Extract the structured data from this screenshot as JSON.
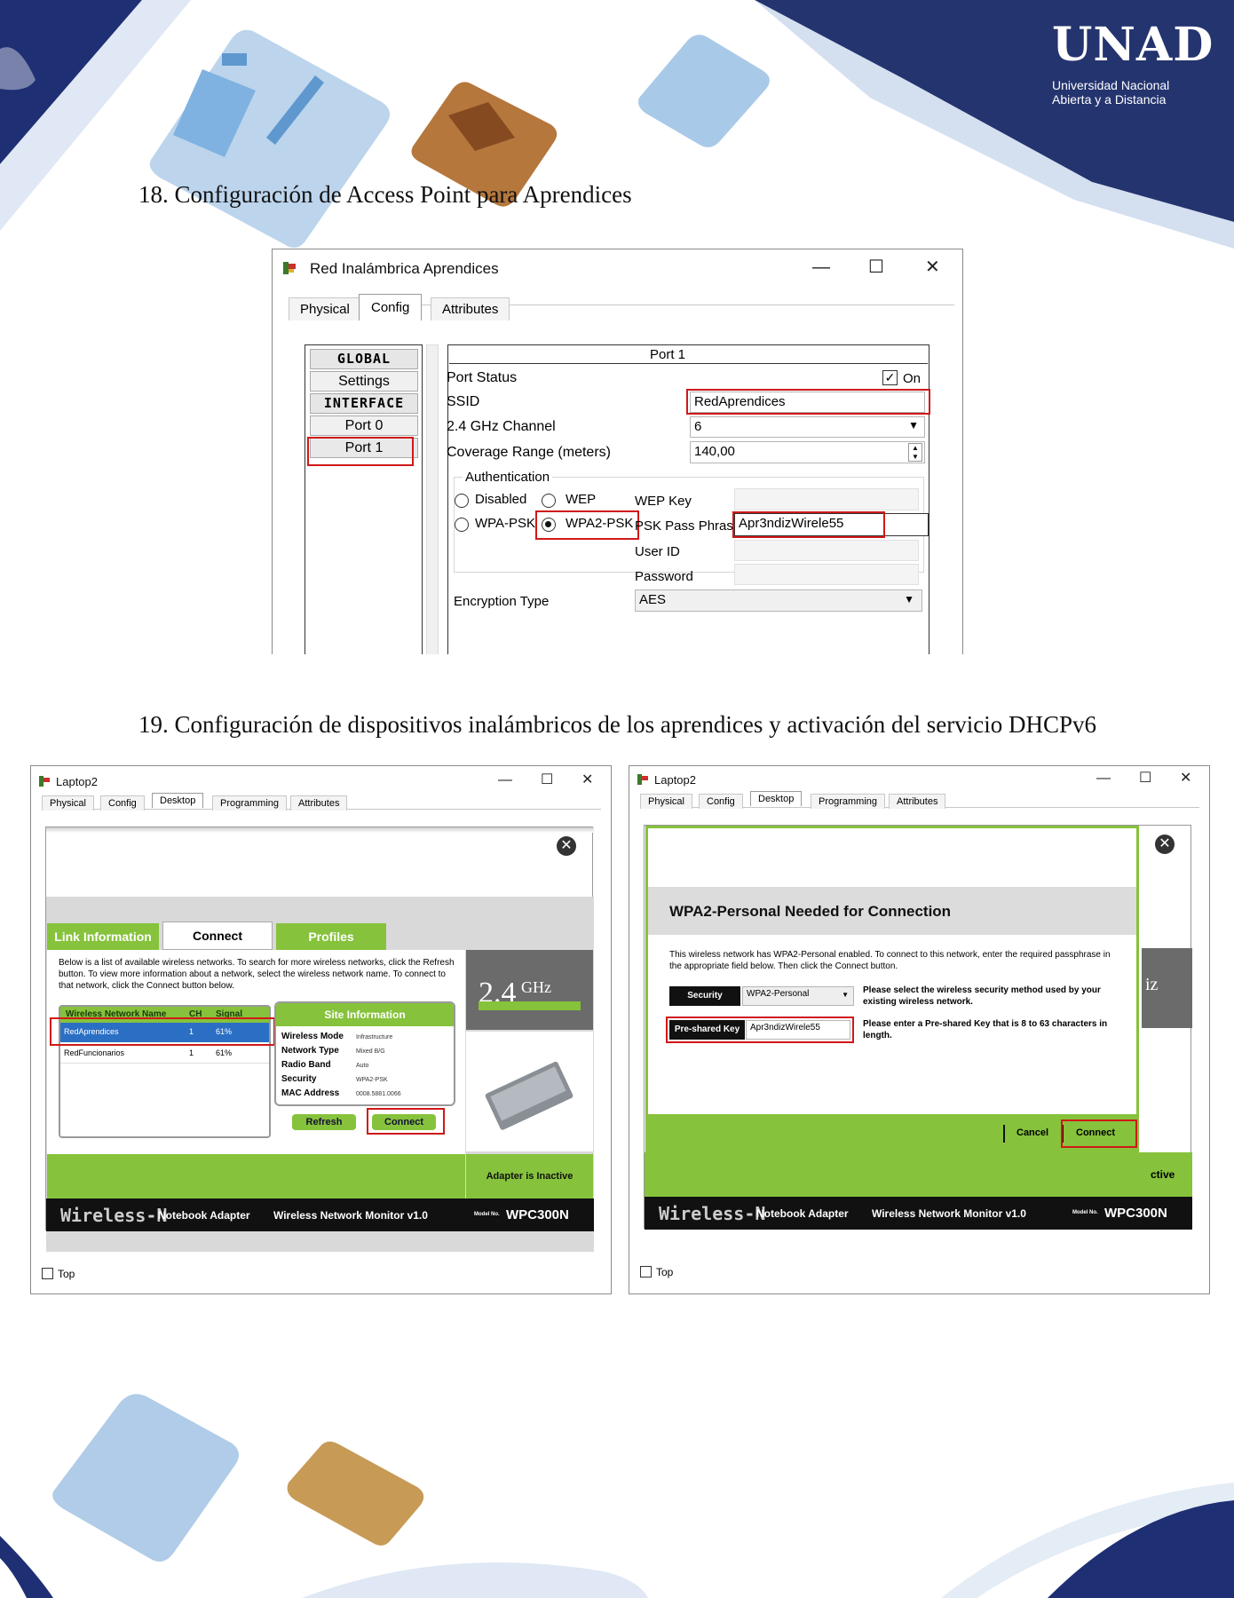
{
  "header": {
    "logo_text": "UNAD",
    "logo_line1": "Universidad Nacional",
    "logo_line2": "Abierta y a Distancia"
  },
  "section18": {
    "heading": "18. Configuración de Access Point para Aprendices",
    "window": {
      "title": "Red Inalámbrica Aprendices",
      "minimize": "—",
      "maximize": "☐",
      "close": "✕",
      "tabs": [
        "Physical",
        "Config",
        "Attributes"
      ],
      "nav": [
        "GLOBAL",
        "Settings",
        "INTERFACE",
        "Port 0",
        "Port 1"
      ],
      "panel_title": "Port 1",
      "port_status_label": "Port Status",
      "port_status_value": "On",
      "ssid_label": "SSID",
      "ssid_value": "RedAprendices",
      "channel_label": "2.4 GHz Channel",
      "channel_value": "6",
      "coverage_label": "Coverage Range (meters)",
      "coverage_value": "140,00",
      "auth_legend": "Authentication",
      "auth_options": [
        "Disabled",
        "WEP",
        "WPA-PSK",
        "WPA2-PSK"
      ],
      "auth_selected": "WPA2-PSK",
      "wep_key_label": "WEP Key",
      "psk_label": "PSK Pass Phrase",
      "psk_value": "Apr3ndizWirele55",
      "user_id_label": "User ID",
      "password_label": "Password",
      "encryption_label": "Encryption Type",
      "encryption_value": "AES"
    }
  },
  "section19": {
    "heading": "19. Configuración de dispositivos inalámbricos de los aprendices y activación del servicio DHCPv6",
    "left": {
      "title": "Laptop2",
      "tabs": [
        "Physical",
        "Config",
        "Desktop",
        "Programming",
        "Attributes"
      ],
      "subtabs": [
        "Link Information",
        "Connect",
        "Profiles"
      ],
      "description": "Below is a list of available wireless networks. To search for more wireless networks, click the Refresh button. To view more information about a network, select the wireless network name. To connect to that network, click the Connect button below.",
      "columns": [
        "Wireless Network Name",
        "CH",
        "Signal"
      ],
      "networks": [
        {
          "name": "RedAprendices",
          "ch": "1",
          "signal": "61%"
        },
        {
          "name": "RedFuncionarios",
          "ch": "1",
          "signal": "61%"
        }
      ],
      "site_info_title": "Site Information",
      "site_info": [
        {
          "k": "Wireless Mode",
          "v": "Infrastructure"
        },
        {
          "k": "Network Type",
          "v": "Mixed B/G"
        },
        {
          "k": "Radio Band",
          "v": "Auto"
        },
        {
          "k": "Security",
          "v": "WPA2-PSK"
        },
        {
          "k": "MAC Address",
          "v": "0008.5881.0066"
        }
      ],
      "refresh": "Refresh",
      "connect": "Connect",
      "ghz_big": "2.4",
      "ghz_unit": "GHz",
      "adapter_status": "Adapter is Inactive",
      "footer_brand": "Wireless-N",
      "footer_product": "Notebook Adapter",
      "footer_monitor": "Wireless Network Monitor  v1.0",
      "footer_model_label": "Model No.",
      "footer_model": "WPC300N",
      "top_checkbox": "Top"
    },
    "right": {
      "title": "Laptop2",
      "tabs": [
        "Physical",
        "Config",
        "Desktop",
        "Programming",
        "Attributes"
      ],
      "dialog_title": "WPA2-Personal Needed for Connection",
      "dialog_text": "This wireless network has WPA2-Personal enabled. To connect to this network, enter the required passphrase in the appropriate field below. Then click the Connect button.",
      "security_label": "Security",
      "security_value": "WPA2-Personal",
      "security_help": "Please select the wireless security method used by your existing wireless network.",
      "psk_label": "Pre-shared Key",
      "psk_value": "Apr3ndizWirele55",
      "psk_help": "Please enter a Pre-shared Key that is 8 to 63 characters in length.",
      "cancel": "Cancel",
      "connect": "Connect",
      "partial_ghz": "iz",
      "partial_status": "ctive",
      "footer_brand": "Wireless-N",
      "footer_product": "Notebook Adapter",
      "footer_monitor": "Wireless Network Monitor  v1.0",
      "footer_model_label": "Model No.",
      "footer_model": "WPC300N",
      "top_checkbox": "Top"
    }
  },
  "colors": {
    "navy": "#1f2f73",
    "light_blue": "#a9c9e8",
    "brown": "#b5773c",
    "linksys_green": "#86c23b",
    "highlight_red": "#d01818"
  }
}
